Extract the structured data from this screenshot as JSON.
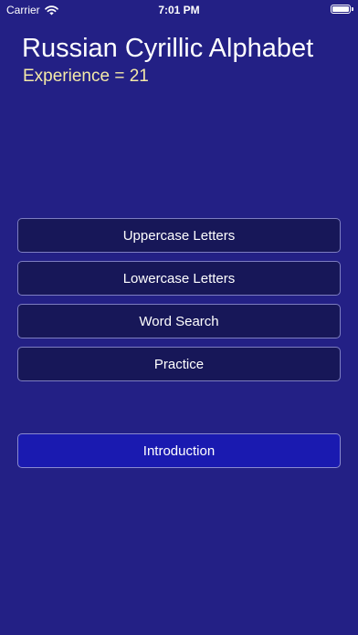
{
  "status_bar": {
    "carrier": "Carrier",
    "time": "7:01 PM"
  },
  "header": {
    "title": "Russian Cyrillic Alphabet",
    "experience_label": "Experience =",
    "experience_value": "21"
  },
  "menu": {
    "uppercase_label": "Uppercase Letters",
    "lowercase_label": "Lowercase Letters",
    "word_search_label": "Word Search",
    "practice_label": "Practice",
    "introduction_label": "Introduction"
  },
  "colors": {
    "background": "#232085",
    "button_fill": "#171758",
    "button_border": "#7d7dc0",
    "intro_fill": "#1a1ab0",
    "experience_text": "#f4e9a8"
  },
  "icons": [
    "wifi-icon",
    "battery-icon"
  ]
}
